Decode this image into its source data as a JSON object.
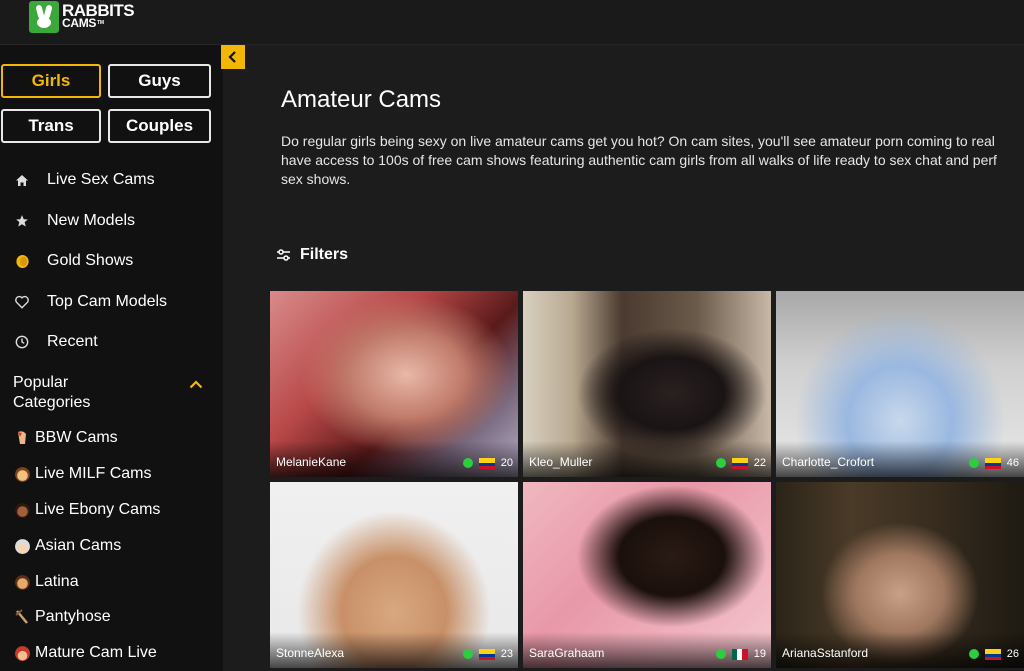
{
  "logo": {
    "line1": "RABBITS",
    "line2": "CAMS",
    "suffix": "TM"
  },
  "sidebar": {
    "gender_buttons": [
      {
        "label": "Girls",
        "active": true
      },
      {
        "label": "Guys",
        "active": false
      },
      {
        "label": "Trans",
        "active": false
      },
      {
        "label": "Couples",
        "active": false
      }
    ],
    "nav": [
      {
        "label": "Live Sex Cams",
        "icon": "home-icon"
      },
      {
        "label": "New Models",
        "icon": "star-icon"
      },
      {
        "label": "Gold Shows",
        "icon": "gold-coin-icon"
      },
      {
        "label": "Top Cam Models",
        "icon": "heart-icon"
      },
      {
        "label": "Recent",
        "icon": "clock-icon"
      }
    ],
    "categories_title": "Popular Categories",
    "categories": [
      {
        "label": "BBW Cams",
        "icon": "bbw-emoji-icon"
      },
      {
        "label": "Live MILF Cams",
        "icon": "milf-emoji-icon"
      },
      {
        "label": "Live Ebony Cams",
        "icon": "ebony-emoji-icon"
      },
      {
        "label": "Asian Cams",
        "icon": "asian-emoji-icon"
      },
      {
        "label": "Latina",
        "icon": "latina-emoji-icon"
      },
      {
        "label": "Pantyhose",
        "icon": "pantyhose-emoji-icon"
      },
      {
        "label": "Mature Cam Live",
        "icon": "mature-emoji-icon"
      }
    ]
  },
  "main": {
    "title": "Amateur Cams",
    "description_lines": [
      "Do regular girls being sexy on live amateur cams get you hot? On cam sites, you'll see amateur porn coming to real",
      "have access to 100s of free cam shows featuring authentic cam girls from all walks of life ready to sex chat and perf",
      "sex shows."
    ],
    "filters_label": "Filters"
  },
  "models": [
    {
      "name": "MelanieKane",
      "count": "20",
      "flag": "co",
      "online": true
    },
    {
      "name": "Kleo_Muller",
      "count": "22",
      "flag": "co",
      "online": true
    },
    {
      "name": "Charlotte_Crofort",
      "count": "46",
      "flag": "co",
      "online": true
    },
    {
      "name": "StonneAlexa",
      "count": "23",
      "flag": "co",
      "online": true
    },
    {
      "name": "SaraGrahaam",
      "count": "19",
      "flag": "mx",
      "online": true
    },
    {
      "name": "ArianaSstanford",
      "count": "26",
      "flag": "co",
      "online": true
    }
  ],
  "colors": {
    "accent": "#f2b705",
    "online": "#2ecc40",
    "brand_green": "#3aa83a"
  }
}
